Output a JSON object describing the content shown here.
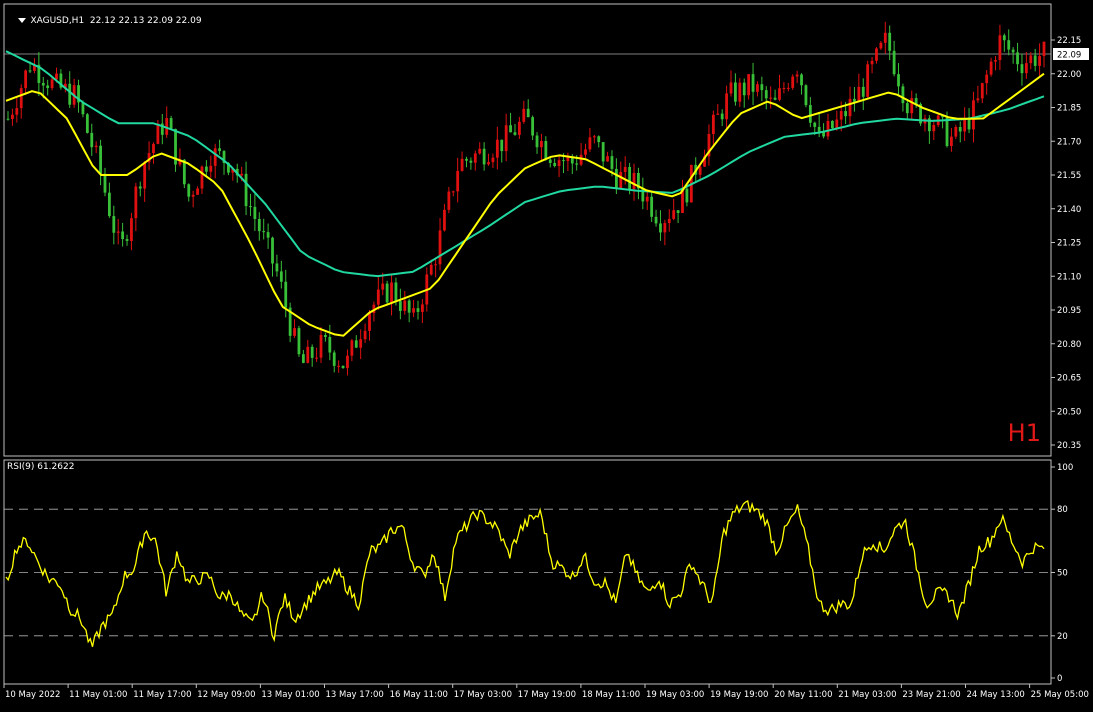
{
  "header": {
    "symbol": "XAGUSD,H1",
    "ohlc": "22.12 22.13 22.09 22.09",
    "timeframe_badge": "H1"
  },
  "rsi_header": "RSI(9) 61.2622",
  "colors": {
    "background": "#000000",
    "frame": "#c0c0c0",
    "bull_candle": "#e01010",
    "bear_candle": "#39c039",
    "ma_fast": "#ffff00",
    "ma_slow": "#20d8a0",
    "rsi_line": "#ffff00",
    "last_price_line": "#aaaaaa"
  },
  "chart_data": [
    {
      "type": "candlestick",
      "symbol": "XAGUSD",
      "timeframe": "H1",
      "ylim": [
        20.35,
        22.2
      ],
      "y_ticks": [
        "22.15",
        "22.00",
        "21.85",
        "21.70",
        "21.55",
        "21.40",
        "21.25",
        "21.10",
        "20.95",
        "20.80",
        "20.65",
        "20.50",
        "20.35"
      ],
      "last_price": "22.09",
      "x_tick_labels": [
        "10 May 2022",
        "11 May 01:00",
        "11 May 17:00",
        "12 May 09:00",
        "13 May 01:00",
        "13 May 17:00",
        "16 May 11:00",
        "17 May 03:00",
        "17 May 19:00",
        "18 May 11:00",
        "19 May 03:00",
        "19 May 19:00",
        "20 May 11:00",
        "21 May 03:00",
        "23 May 21:00",
        "24 May 13:00",
        "25 May 05:00"
      ],
      "close_path": [
        21.8,
        22.05,
        21.95,
        21.9,
        21.6,
        21.2,
        21.6,
        21.8,
        21.45,
        21.65,
        21.6,
        21.35,
        21.1,
        20.7,
        20.8,
        20.7,
        20.95,
        21.05,
        20.9,
        21.2,
        21.6,
        21.65,
        21.7,
        21.8,
        21.65,
        21.6,
        21.7,
        21.55,
        21.5,
        21.35,
        21.45,
        21.7,
        21.9,
        21.95,
        21.85,
        22.05,
        21.7,
        21.8,
        21.95,
        22.15,
        21.85,
        21.8,
        21.7,
        21.85,
        22.15,
        22.05,
        22.09
      ],
      "ma_fast_path": [
        21.88,
        21.93,
        21.8,
        21.55,
        21.55,
        21.65,
        21.6,
        21.5,
        21.25,
        20.97,
        20.88,
        20.83,
        20.95,
        21.0,
        21.05,
        21.25,
        21.45,
        21.58,
        21.64,
        21.62,
        21.55,
        21.48,
        21.45,
        21.65,
        21.82,
        21.88,
        21.8,
        21.84,
        21.88,
        21.92,
        21.85,
        21.8,
        21.8,
        21.9,
        22.0
      ],
      "ma_slow_path": [
        22.1,
        22.02,
        21.88,
        21.78,
        21.78,
        21.72,
        21.6,
        21.42,
        21.2,
        21.12,
        21.1,
        21.12,
        21.22,
        21.32,
        21.43,
        21.48,
        21.5,
        21.48,
        21.47,
        21.55,
        21.65,
        21.72,
        21.74,
        21.78,
        21.8,
        21.79,
        21.8,
        21.84,
        21.9
      ]
    },
    {
      "type": "line",
      "name": "RSI(9)",
      "ylim": [
        0,
        100
      ],
      "y_ticks": [
        "100",
        "80",
        "50",
        "20",
        "0"
      ],
      "levels": [
        80,
        50,
        20
      ],
      "last_value": 61.2622,
      "values": [
        45,
        62,
        65,
        55,
        47,
        45,
        33,
        28,
        14,
        25,
        30,
        48,
        52,
        70,
        65,
        40,
        60,
        45,
        47,
        48,
        38,
        40,
        30,
        25,
        40,
        20,
        38,
        28,
        35,
        42,
        45,
        50,
        42,
        35,
        60,
        62,
        70,
        72,
        55,
        48,
        60,
        38,
        65,
        72,
        78,
        75,
        70,
        58,
        70,
        75,
        78,
        55,
        52,
        48,
        58,
        46,
        45,
        35,
        60,
        48,
        40,
        48,
        35,
        40,
        55,
        45,
        35,
        68,
        78,
        82,
        80,
        75,
        60,
        72,
        80,
        60,
        35,
        32,
        35,
        35,
        58,
        65,
        60,
        70,
        75,
        55,
        35,
        40,
        40,
        30,
        45,
        62,
        65,
        76,
        65,
        55,
        62,
        61.26
      ]
    }
  ]
}
